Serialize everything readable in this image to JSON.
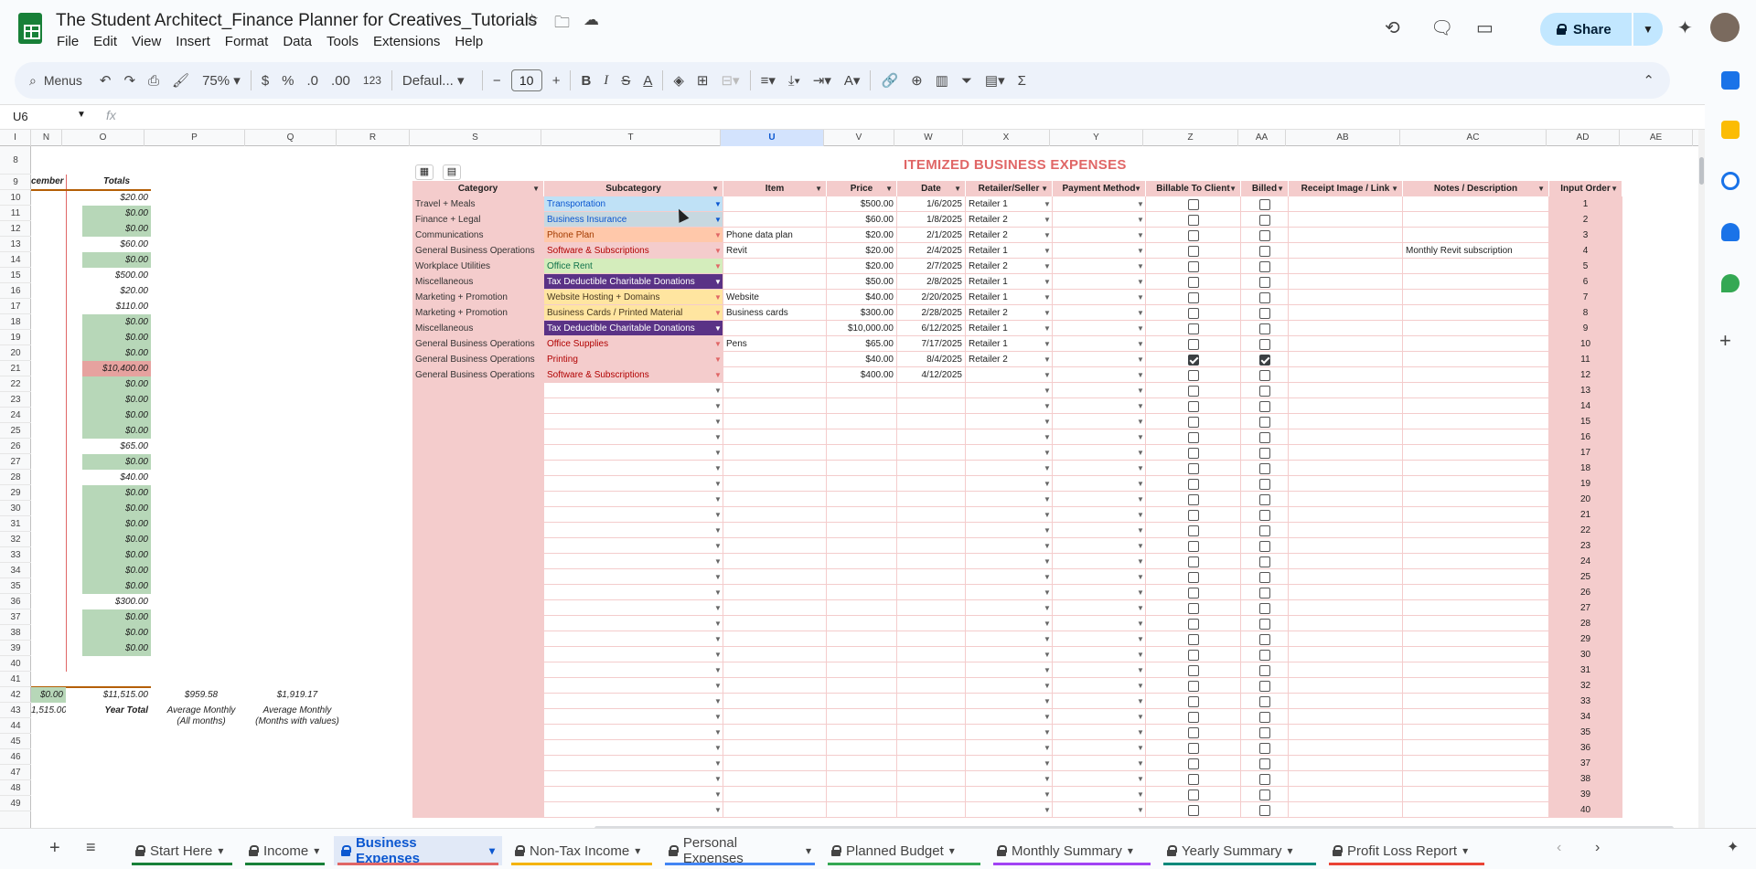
{
  "doc_title": "The Student Architect_Finance Planner for Creatives_Tutorials",
  "menu": [
    "File",
    "Edit",
    "View",
    "Insert",
    "Format",
    "Data",
    "Tools",
    "Extensions",
    "Help"
  ],
  "share_label": "Share",
  "toolbar": {
    "menus": "Menus",
    "zoom": "75%",
    "currency": "$",
    "percent": "%",
    "dec_dec": ".0",
    "dec_inc": ".00",
    "numfmt": "123",
    "font": "Defaul...",
    "font_size": "10"
  },
  "name_box": "U6",
  "fx": "fx",
  "columns": [
    {
      "l": "I"
    },
    {
      "l": "N"
    },
    {
      "l": "O"
    },
    {
      "l": "P"
    },
    {
      "l": "Q"
    },
    {
      "l": "R"
    },
    {
      "l": "S"
    },
    {
      "l": "T"
    },
    {
      "l": "U",
      "sel": true
    },
    {
      "l": "V"
    },
    {
      "l": "W"
    },
    {
      "l": "X"
    },
    {
      "l": "Y"
    },
    {
      "l": "Z"
    },
    {
      "l": "AA"
    },
    {
      "l": "AB"
    },
    {
      "l": "AC"
    },
    {
      "l": "AD"
    },
    {
      "l": "AE"
    }
  ],
  "rows": [
    8,
    9,
    10,
    11,
    12,
    13,
    14,
    15,
    16,
    17,
    18,
    19,
    20,
    21,
    22,
    23,
    24,
    25,
    26,
    27,
    28,
    29,
    30,
    31,
    32,
    33,
    34,
    35,
    36,
    37,
    38,
    39,
    40,
    41,
    42,
    43,
    44,
    45,
    46,
    47,
    48,
    49
  ],
  "left_panel": {
    "header_december": "cember",
    "header_totals": "Totals",
    "totals": [
      {
        "v": "$20.00",
        "s": ""
      },
      {
        "v": "$0.00",
        "s": "g"
      },
      {
        "v": "$0.00",
        "s": "g"
      },
      {
        "v": "$60.00",
        "s": ""
      },
      {
        "v": "$0.00",
        "s": "g"
      },
      {
        "v": "$500.00",
        "s": ""
      },
      {
        "v": "$20.00",
        "s": ""
      },
      {
        "v": "$110.00",
        "s": ""
      },
      {
        "v": "$0.00",
        "s": "g"
      },
      {
        "v": "$0.00",
        "s": "g"
      },
      {
        "v": "$0.00",
        "s": "g"
      },
      {
        "v": "$10,400.00",
        "s": "r"
      },
      {
        "v": "$0.00",
        "s": "g"
      },
      {
        "v": "$0.00",
        "s": "g"
      },
      {
        "v": "$0.00",
        "s": "g"
      },
      {
        "v": "$0.00",
        "s": "g"
      },
      {
        "v": "$65.00",
        "s": ""
      },
      {
        "v": "$0.00",
        "s": "g"
      },
      {
        "v": "$40.00",
        "s": ""
      },
      {
        "v": "$0.00",
        "s": "g"
      },
      {
        "v": "$0.00",
        "s": "g"
      },
      {
        "v": "$0.00",
        "s": "g"
      },
      {
        "v": "$0.00",
        "s": "g"
      },
      {
        "v": "$0.00",
        "s": "g"
      },
      {
        "v": "$0.00",
        "s": "g"
      },
      {
        "v": "$0.00",
        "s": "g"
      },
      {
        "v": "$300.00",
        "s": ""
      },
      {
        "v": "$0.00",
        "s": "g"
      },
      {
        "v": "$0.00",
        "s": "g"
      },
      {
        "v": "$0.00",
        "s": "g"
      }
    ],
    "dec_total": "$0.00",
    "dec_year": "1,515.00",
    "grand_total": "$11,515.00",
    "year_total_label": "Year Total",
    "avg_all": "$959.58",
    "avg_all_label": [
      "Average Monthly",
      "(All months)"
    ],
    "avg_vals": "$1,919.17",
    "avg_vals_label": [
      "Average Monthly",
      "(Months with values)"
    ]
  },
  "table_title": "ITEMIZED BUSINESS EXPENSES",
  "table_headers": [
    "Category",
    "Subcategory",
    "Item",
    "Price",
    "Date",
    "Retailer/Seller",
    "Payment Method",
    "Billable To Client",
    "Billed",
    "Receipt Image / Link",
    "Notes / Description",
    "Input Order"
  ],
  "expenses": [
    {
      "cat": "Travel + Meals",
      "sub": "Transportation",
      "subbg": "#bfe1f6",
      "subfg": "#0b57d0",
      "item": "",
      "price": "$500.00",
      "date": "1/6/2025",
      "ret": "Retailer 1",
      "bill": false,
      "billed": false,
      "notes": ""
    },
    {
      "cat": "Finance + Legal",
      "sub": "Business Insurance",
      "subbg": "#c7d8e0",
      "subfg": "#0b57d0",
      "item": "",
      "price": "$60.00",
      "date": "1/8/2025",
      "ret": "Retailer 2",
      "bill": false,
      "billed": false,
      "notes": ""
    },
    {
      "cat": "Communications",
      "sub": "Phone Plan",
      "subbg": "#ffc8aa",
      "subfg": "#a33b00",
      "item": "Phone data plan",
      "price": "$20.00",
      "date": "2/1/2025",
      "ret": "Retailer 2",
      "bill": false,
      "billed": false,
      "notes": ""
    },
    {
      "cat": "General Business Operations",
      "sub": "Software & Subscriptions",
      "subbg": "#f4cccc",
      "subfg": "#b10202",
      "item": "Revit",
      "price": "$20.00",
      "date": "2/4/2025",
      "ret": "Retailer 1",
      "bill": false,
      "billed": false,
      "notes": "Monthly Revit subscription"
    },
    {
      "cat": "Workplace Utilities",
      "sub": "Office Rent",
      "subbg": "#d4edbc",
      "subfg": "#11734b",
      "item": "",
      "price": "$20.00",
      "date": "2/7/2025",
      "ret": "Retailer 2",
      "bill": false,
      "billed": false,
      "notes": ""
    },
    {
      "cat": "Miscellaneous",
      "sub": "Tax Deductible Charitable Donations",
      "subbg": "#5a3286",
      "subfg": "#ffffff",
      "item": "",
      "price": "$50.00",
      "date": "2/8/2025",
      "ret": "Retailer 1",
      "bill": false,
      "billed": false,
      "notes": ""
    },
    {
      "cat": "Marketing + Promotion",
      "sub": "Website Hosting + Domains",
      "subbg": "#ffe5a0",
      "subfg": "#473821",
      "item": "Website",
      "price": "$40.00",
      "date": "2/20/2025",
      "ret": "Retailer 1",
      "bill": false,
      "billed": false,
      "notes": ""
    },
    {
      "cat": "Marketing + Promotion",
      "sub": "Business Cards / Printed Material",
      "subbg": "#ffe5a0",
      "subfg": "#473821",
      "item": "Business cards",
      "price": "$300.00",
      "date": "2/28/2025",
      "ret": "Retailer 2",
      "bill": false,
      "billed": false,
      "notes": ""
    },
    {
      "cat": "Miscellaneous",
      "sub": "Tax Deductible Charitable Donations",
      "subbg": "#5a3286",
      "subfg": "#ffffff",
      "item": "",
      "price": "$10,000.00",
      "date": "6/12/2025",
      "ret": "Retailer 1",
      "bill": false,
      "billed": false,
      "notes": ""
    },
    {
      "cat": "General Business Operations",
      "sub": "Office Supplies",
      "subbg": "#f4cccc",
      "subfg": "#b10202",
      "item": "Pens",
      "price": "$65.00",
      "date": "7/17/2025",
      "ret": "Retailer 1",
      "bill": false,
      "billed": false,
      "notes": ""
    },
    {
      "cat": "General Business Operations",
      "sub": "Printing",
      "subbg": "#f4cccc",
      "subfg": "#b10202",
      "item": "",
      "price": "$40.00",
      "date": "8/4/2025",
      "ret": "Retailer 2",
      "bill": true,
      "billed": true,
      "notes": ""
    },
    {
      "cat": "General Business Operations",
      "sub": "Software & Subscriptions",
      "subbg": "#f4cccc",
      "subfg": "#b10202",
      "item": "",
      "price": "$400.00",
      "date": "4/12/2025",
      "ret": "",
      "bill": false,
      "billed": false,
      "notes": ""
    }
  ],
  "input_orders": [
    "1",
    "2",
    "3",
    "4",
    "5",
    "6",
    "7",
    "8",
    "9",
    "10",
    "11",
    "12",
    "13",
    "14",
    "15",
    "16",
    "17",
    "18",
    "19",
    "20",
    "21",
    "22",
    "23",
    "24",
    "25",
    "26",
    "27",
    "28",
    "29",
    "30",
    "31",
    "32",
    "33",
    "34",
    "35",
    "36",
    "37",
    "38",
    "39",
    "40"
  ],
  "tabs": [
    {
      "label": "Start Here",
      "color": "#188038"
    },
    {
      "label": "Income",
      "color": "#188038"
    },
    {
      "label": "Business Expenses",
      "color": "#e06666",
      "active": true
    },
    {
      "label": "Non-Tax Income",
      "color": "#f4b400"
    },
    {
      "label": "Personal Expenses",
      "color": "#4285f4"
    },
    {
      "label": "Planned Budget",
      "color": "#34a853"
    },
    {
      "label": "Monthly Summary",
      "color": "#a142f4"
    },
    {
      "label": "Yearly Summary",
      "color": "#00897b"
    },
    {
      "label": "Profit Loss Report",
      "color": "#ea4335"
    }
  ]
}
